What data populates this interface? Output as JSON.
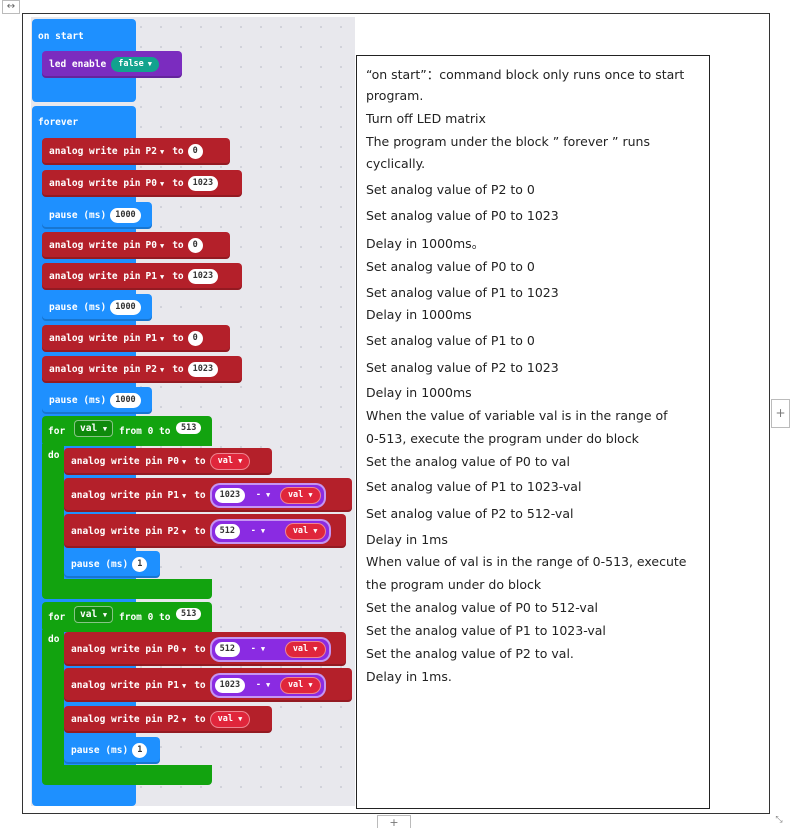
{
  "doc": {
    "move_handle": "↔",
    "add_column": "+",
    "add_row": "+",
    "resize": "⤡"
  },
  "blocks": {
    "on_start": "on start",
    "led_enable": "led enable",
    "false": "false",
    "forever": "forever",
    "analog_write_pin": "analog write pin",
    "to": "to",
    "pause": "pause (ms)",
    "for": "for",
    "from": "from 0 to",
    "do": "do",
    "minus": "-",
    "caret": "▼",
    "pins": [
      "P2",
      "P0",
      "P0",
      "P1",
      "P1",
      "P2",
      "P0",
      "P1",
      "P2",
      "P0",
      "P1",
      "P2"
    ],
    "values": [
      "0",
      "1023",
      "0",
      "1023",
      "0",
      "1023"
    ],
    "pause_values": [
      "1000",
      "1000",
      "1000",
      "1",
      "1"
    ],
    "loop_var": "val",
    "loop_end": "513",
    "n1023": "1023",
    "n512": "512"
  },
  "notes": [
    "“on start”：command block only runs once to start",
    "program.",
    "Turn off LED matrix",
    "The  program  under  the  block  ”  forever ”    runs",
    "cyclically.",
    "Set analog value of P2 to 0",
    "Set analog value of P0 to 1023",
    "Delay in 1000ms。",
    "Set analog value of P0 to 0",
    "Set analog value of P1 to 1023",
    "Delay in 1000ms",
    "Set analog value of P1 to 0",
    "Set analog value of P2 to 1023",
    "Delay in 1000ms",
    "When  the  value  of  variable  val  is  in  the  range  of",
    "0-513, execute the program under do block",
    "Set the analog value of P0 to val",
    "Set analog value of P1 to 1023-val",
    "Set analog value of P2 to 512-val",
    "Delay in 1ms",
    "When  value  of  val  is  in  the  range  of  0-513,  execute",
    "the program under do block",
    "Set the analog value of P0 to 512-val",
    "Set the analog value of P1 to 1023-val",
    "Set the analog value of P2 to val.",
    "Delay in 1ms."
  ]
}
